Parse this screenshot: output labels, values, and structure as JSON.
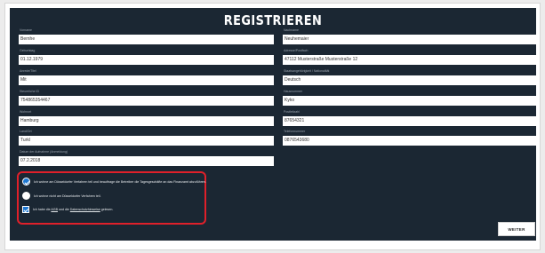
{
  "title": "REGISTRIEREN",
  "fields": {
    "vorname": {
      "label": "Vorname",
      "value": "Bernhe"
    },
    "nachname": {
      "label": "Nachname",
      "value": "Neuhemaier"
    },
    "geburtsdatum": {
      "label": "Geburtstag",
      "value": "01.12.1979"
    },
    "adresse": {
      "label": "Adresse/Postfach",
      "value": "47112 Musterstraße Musterstraße 12"
    },
    "anrede": {
      "label": "Anrede/Titel",
      "value": "Mit"
    },
    "staatsangehoerigkeit": {
      "label": "Staatsangehörigkeit / Nationalität",
      "value": "Deutsch"
    },
    "steuer_id": {
      "label": "Steuerliche ID",
      "value": "754865354467"
    },
    "hausnummer": {
      "label": "Hausnummer",
      "value": "Kyko"
    },
    "ort": {
      "label": "Wohnort",
      "value": "Hamburg"
    },
    "plz": {
      "label": "Postleitzahl",
      "value": "87654321"
    },
    "land": {
      "label": "Land/Ort",
      "value": "Turkl"
    },
    "telefon": {
      "label": "Telefonnummer",
      "value": "0876543680"
    },
    "aufnahme": {
      "label": "Datum der Aufnahme (Anmeldung)",
      "value": "07.2.2018"
    }
  },
  "consent": {
    "option1": "Ich wohne am Düsseldorfer Verfahren teil und beauftrage die Betreiber die Tagesgeschäfte an das Finanzamt abzuführen.",
    "option2": "Ich wohne nicht am Düsseldorfer Verfahren teil.",
    "check_prefix": "Ich habe die ",
    "agb_link": "AGB",
    "check_middle": " und die ",
    "privacy_link": "Datenschutzhinweise",
    "check_suffix": " gelesen."
  },
  "buttons": {
    "next": "WEITER"
  },
  "colors": {
    "panel": "#1b2733",
    "accent": "#1e78d2",
    "highlight": "#e0202a"
  }
}
